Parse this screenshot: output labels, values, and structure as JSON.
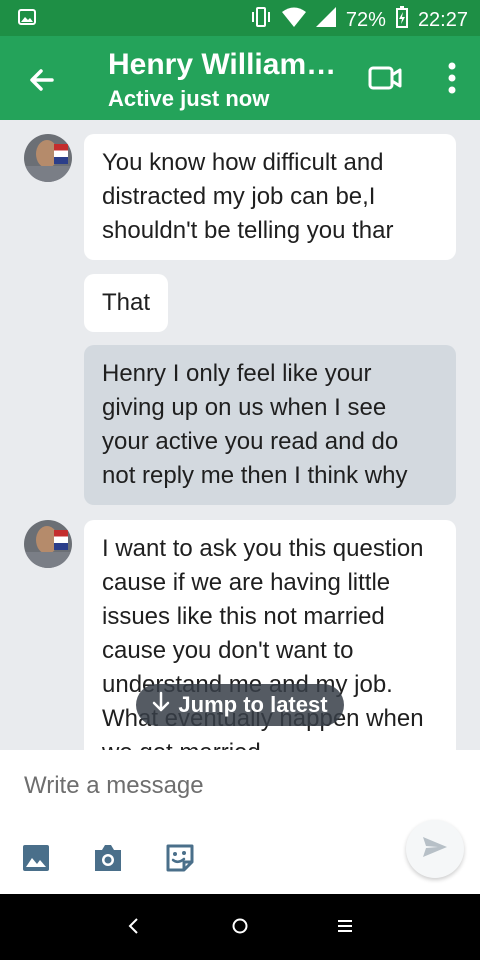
{
  "status_bar": {
    "battery": "72%",
    "time": "22:27"
  },
  "header": {
    "title": "Henry Williams…",
    "subtitle": "Active just now"
  },
  "messages": [
    {
      "direction": "incoming",
      "text": "You know how difficult and distracted my job can be,I shouldn't be telling you thar"
    },
    {
      "direction": "incoming",
      "text": "That"
    },
    {
      "direction": "outgoing",
      "text": "Henry I only feel like your giving up on us when I see your active you read and do not reply me then I think why"
    },
    {
      "direction": "incoming",
      "text": "I want to ask you this question cause if we are having little issues like this not married cause you don't want to understand me and my job. What eventually happen when we get married"
    }
  ],
  "jump_to_latest": {
    "label": "Jump to latest"
  },
  "composer": {
    "placeholder": "Write a message"
  },
  "icons": {
    "back": "arrow-left-icon",
    "video": "video-camera-icon",
    "menu": "more-vert-icon",
    "image": "image-icon",
    "camera": "camera-icon",
    "sticker": "sticker-icon",
    "send": "send-icon",
    "nav_back": "nav-back-icon",
    "nav_home": "nav-home-icon",
    "nav_recents": "nav-recents-icon"
  },
  "colors": {
    "status_bar": "#1e8f45",
    "app_bar": "#24a35a",
    "chat_background": "#e9ebee",
    "incoming_bubble": "#ffffff",
    "outgoing_bubble": "#d3d9df"
  }
}
